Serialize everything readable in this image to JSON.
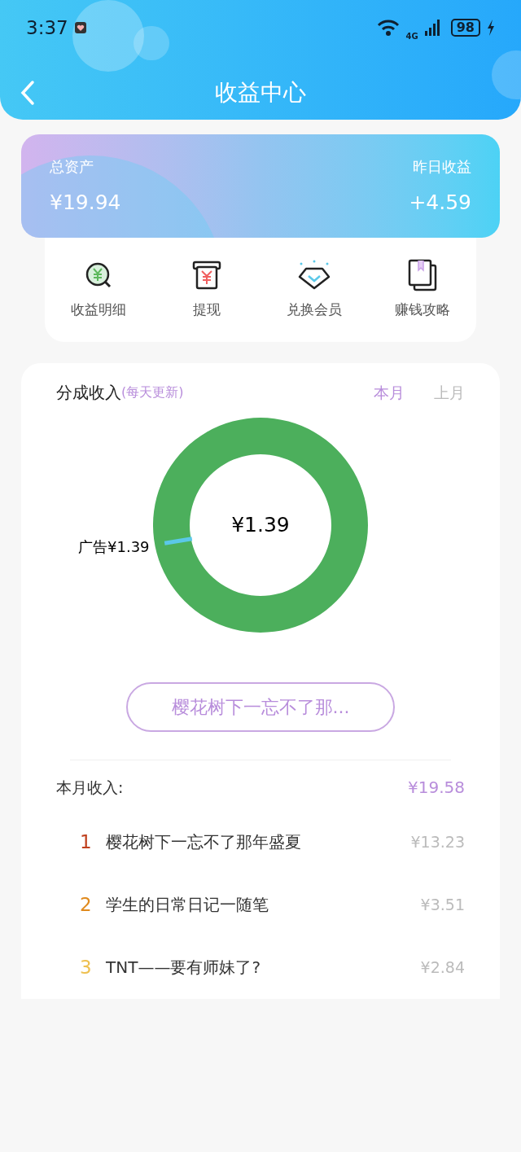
{
  "status_bar": {
    "time": "3:37",
    "network": "4G",
    "battery": "98"
  },
  "header": {
    "title": "收益中心"
  },
  "assets": {
    "total_label": "总资产",
    "total_value": "¥19.94",
    "yesterday_label": "昨日收益",
    "yesterday_value": "+4.59"
  },
  "shortcuts": [
    {
      "kind": "details",
      "label": "收益明细"
    },
    {
      "kind": "withdraw",
      "label": "提现"
    },
    {
      "kind": "vip",
      "label": "兑换会员"
    },
    {
      "kind": "guide",
      "label": "赚钱攻略"
    }
  ],
  "share_income": {
    "title": "分成收入",
    "note": "(每天更新)",
    "tabs": [
      {
        "label": "本月",
        "selected": true
      },
      {
        "label": "上月",
        "selected": false
      }
    ],
    "ring": {
      "label": "广告¥1.39"
    },
    "center_value": "¥1.39",
    "work_button": "樱花树下一忘不了那..."
  },
  "month_income": {
    "label": "本月收入:",
    "total": "¥19.58",
    "items": [
      {
        "rank": "1",
        "color": "#c0401e",
        "title": "樱花树下一忘不了那年盛夏",
        "amount": "¥13.23"
      },
      {
        "rank": "2",
        "color": "#e08a1e",
        "title": "学生的日常日记一随笔",
        "amount": "¥3.51"
      },
      {
        "rank": "3",
        "color": "#eec050",
        "title": "TNT——要有师妹了?",
        "amount": "¥2.84"
      }
    ]
  }
}
